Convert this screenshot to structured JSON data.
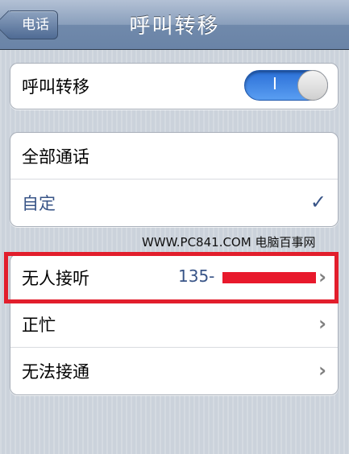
{
  "navbar": {
    "title": "呼叫转移",
    "back_label": "电话"
  },
  "toggle_group": {
    "label": "呼叫转移",
    "switch_state": "on",
    "switch_on_text": "I"
  },
  "mode_group": {
    "items": [
      {
        "label": "全部通话",
        "selected": false
      },
      {
        "label": "自定",
        "selected": true
      }
    ]
  },
  "watermark": "WWW.PC841.COM 电脑百事网",
  "forward_group": {
    "items": [
      {
        "label": "无人接听",
        "value": "135-"
      },
      {
        "label": "正忙",
        "value": ""
      },
      {
        "label": "无法接通",
        "value": ""
      }
    ]
  },
  "colors": {
    "accent": "#385487",
    "switch_on": "#2a6fd6",
    "highlight": "#e21e2c"
  }
}
